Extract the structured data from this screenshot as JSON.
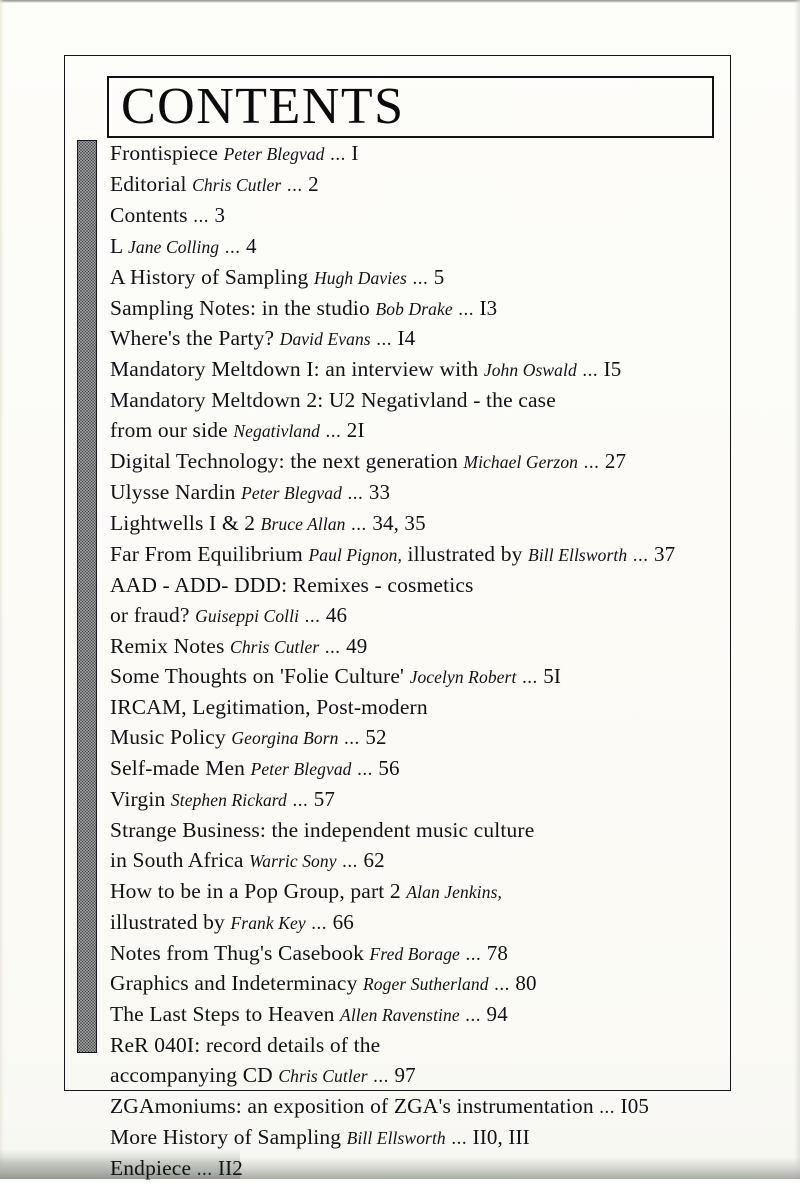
{
  "page": {
    "title": "CONTENTS",
    "colors": {
      "ink": "#111215",
      "frame": "#15161a",
      "paper": "#fdfdfa",
      "stipple": "#3a3b3e"
    }
  },
  "contents": {
    "separator": "...",
    "entries": [
      {
        "title": "Frontispiece",
        "author": "Peter Blegvad",
        "page": "I"
      },
      {
        "title": "Editorial",
        "author": "Chris Cutler",
        "page": "2"
      },
      {
        "title": "Contents",
        "author": "",
        "page": "3"
      },
      {
        "title": "L",
        "author": "Jane Colling",
        "page": "4"
      },
      {
        "title": "A History of Sampling",
        "author": "Hugh Davies",
        "page": "5"
      },
      {
        "title": "Sampling Notes: in the studio",
        "author": "Bob Drake",
        "page": "I3"
      },
      {
        "title": "Where's the Party?",
        "author": "David Evans",
        "page": "I4"
      },
      {
        "title": "Mandatory Meltdown I: an interview with",
        "author": "John Oswald",
        "page": "I5"
      },
      {
        "title": "Mandatory Meltdown 2: U2 Negativland - the case",
        "author": "",
        "page": "",
        "continues": true
      },
      {
        "title": "from our side",
        "author": "Negativland",
        "page": "2I",
        "continuation": true
      },
      {
        "title": "Digital Technology: the next generation",
        "author": "Michael Gerzon",
        "page": "27"
      },
      {
        "title": "Ulysse Nardin",
        "author": "Peter Blegvad",
        "page": "33"
      },
      {
        "title": "Lightwells I & 2",
        "author": "Bruce Allan",
        "page": "34, 35"
      },
      {
        "title": "Far From Equilibrium",
        "author": "Paul Pignon,",
        "mid": "illustrated by",
        "author2": "Bill Ellsworth",
        "page": "37"
      },
      {
        "title": "AAD - ADD- DDD: Remixes - cosmetics",
        "author": "",
        "page": "",
        "continues": true
      },
      {
        "title": "or fraud?",
        "author": "Guiseppi Colli",
        "page": "46",
        "continuation": true
      },
      {
        "title": "Remix Notes",
        "author": "Chris Cutler",
        "page": "49"
      },
      {
        "title": "Some Thoughts on 'Folie Culture'",
        "author": "Jocelyn Robert",
        "page": "5I"
      },
      {
        "title": "IRCAM, Legitimation, Post-modern",
        "author": "",
        "page": "",
        "continues": true
      },
      {
        "title": "Music Policy",
        "author": "Georgina Born",
        "page": "52",
        "continuation": true
      },
      {
        "title": "Self-made Men",
        "author": "Peter Blegvad",
        "page": "56"
      },
      {
        "title": "Virgin",
        "author": "Stephen Rickard",
        "page": "57"
      },
      {
        "title": "Strange Business: the independent music culture",
        "author": "",
        "page": "",
        "continues": true
      },
      {
        "title": "in South Africa",
        "author": "Warric Sony",
        "page": "62",
        "continuation": true
      },
      {
        "title": "How to be in a Pop Group, part 2",
        "author": "Alan Jenkins,",
        "page": "",
        "continues": true
      },
      {
        "title": "illustrated by",
        "author": "Frank Key",
        "page": "66",
        "continuation": true
      },
      {
        "title": "Notes from Thug's Casebook",
        "author": "Fred Borage",
        "page": "78"
      },
      {
        "title": "Graphics and Indeterminacy",
        "author": "Roger Sutherland",
        "page": "80"
      },
      {
        "title": "The Last Steps to Heaven",
        "author": "Allen Ravenstine",
        "page": "94"
      },
      {
        "title": "ReR 040I: record details of the",
        "author": "",
        "page": "",
        "continues": true
      },
      {
        "title": "accompanying CD",
        "author": "Chris Cutler",
        "page": "97",
        "continuation": true
      },
      {
        "title": "ZGAmoniums: an exposition of ZGA's instrumentation",
        "author": "",
        "page": "I05"
      },
      {
        "title": "More History of Sampling",
        "author": "Bill Ellsworth",
        "page": "II0, III"
      },
      {
        "title": "Endpiece",
        "author": "",
        "page": "II2"
      }
    ]
  }
}
